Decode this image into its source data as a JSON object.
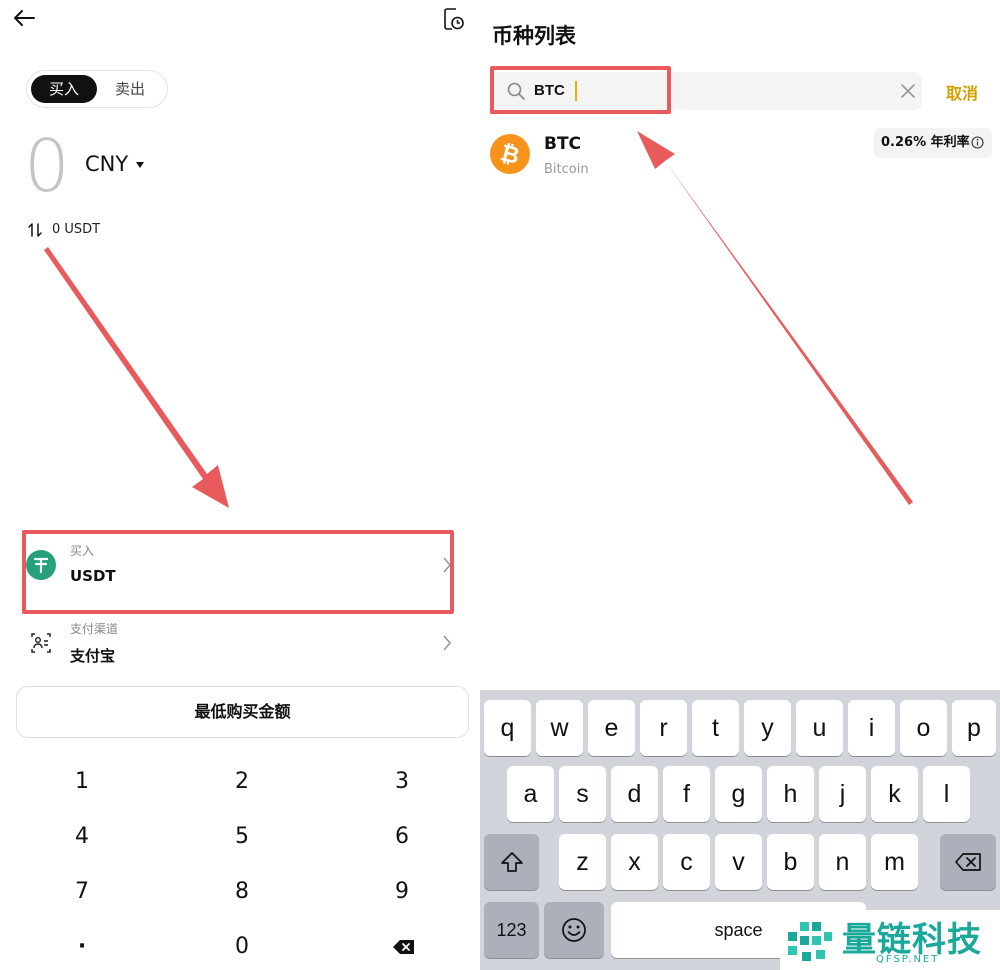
{
  "left": {
    "tabs": {
      "buy": "买入",
      "sell": "卖出"
    },
    "amount": "0",
    "currency": "CNY",
    "usdt_line": "0 USDT",
    "buy_row": {
      "label": "买入",
      "value": "USDT"
    },
    "pay_row": {
      "label": "支付渠道",
      "value": "支付宝"
    },
    "min_button": "最低购买金额",
    "numpad": [
      "1",
      "2",
      "3",
      "4",
      "5",
      "6",
      "7",
      "8",
      "9",
      "·",
      "0"
    ]
  },
  "right": {
    "title": "币种列表",
    "search_value": "BTC",
    "cancel": "取消",
    "coin": {
      "symbol": "BTC",
      "name": "Bitcoin",
      "rate": "0.26% 年利率"
    },
    "keyboard": {
      "row1": [
        "q",
        "w",
        "e",
        "r",
        "t",
        "y",
        "u",
        "i",
        "o",
        "p"
      ],
      "row2": [
        "a",
        "s",
        "d",
        "f",
        "g",
        "h",
        "j",
        "k",
        "l"
      ],
      "row3": [
        "z",
        "x",
        "c",
        "v",
        "b",
        "n",
        "m"
      ],
      "numbers_key": "123",
      "space": "space"
    }
  },
  "watermark": {
    "text": "量链科技",
    "sub": "QFSP.NET"
  },
  "colors": {
    "highlight": "#e85a5c",
    "accent": "#d2a100",
    "usdt": "#26a17b",
    "btc": "#f7931a"
  },
  "icons": [
    "back-arrow-icon",
    "history-icon",
    "swap-icon",
    "usdt-logo-icon",
    "payment-icon",
    "chevron-right-icon",
    "delete-icon",
    "search-icon",
    "clear-icon",
    "bitcoin-logo-icon",
    "info-icon",
    "shift-icon",
    "backspace-icon",
    "emoji-icon"
  ]
}
